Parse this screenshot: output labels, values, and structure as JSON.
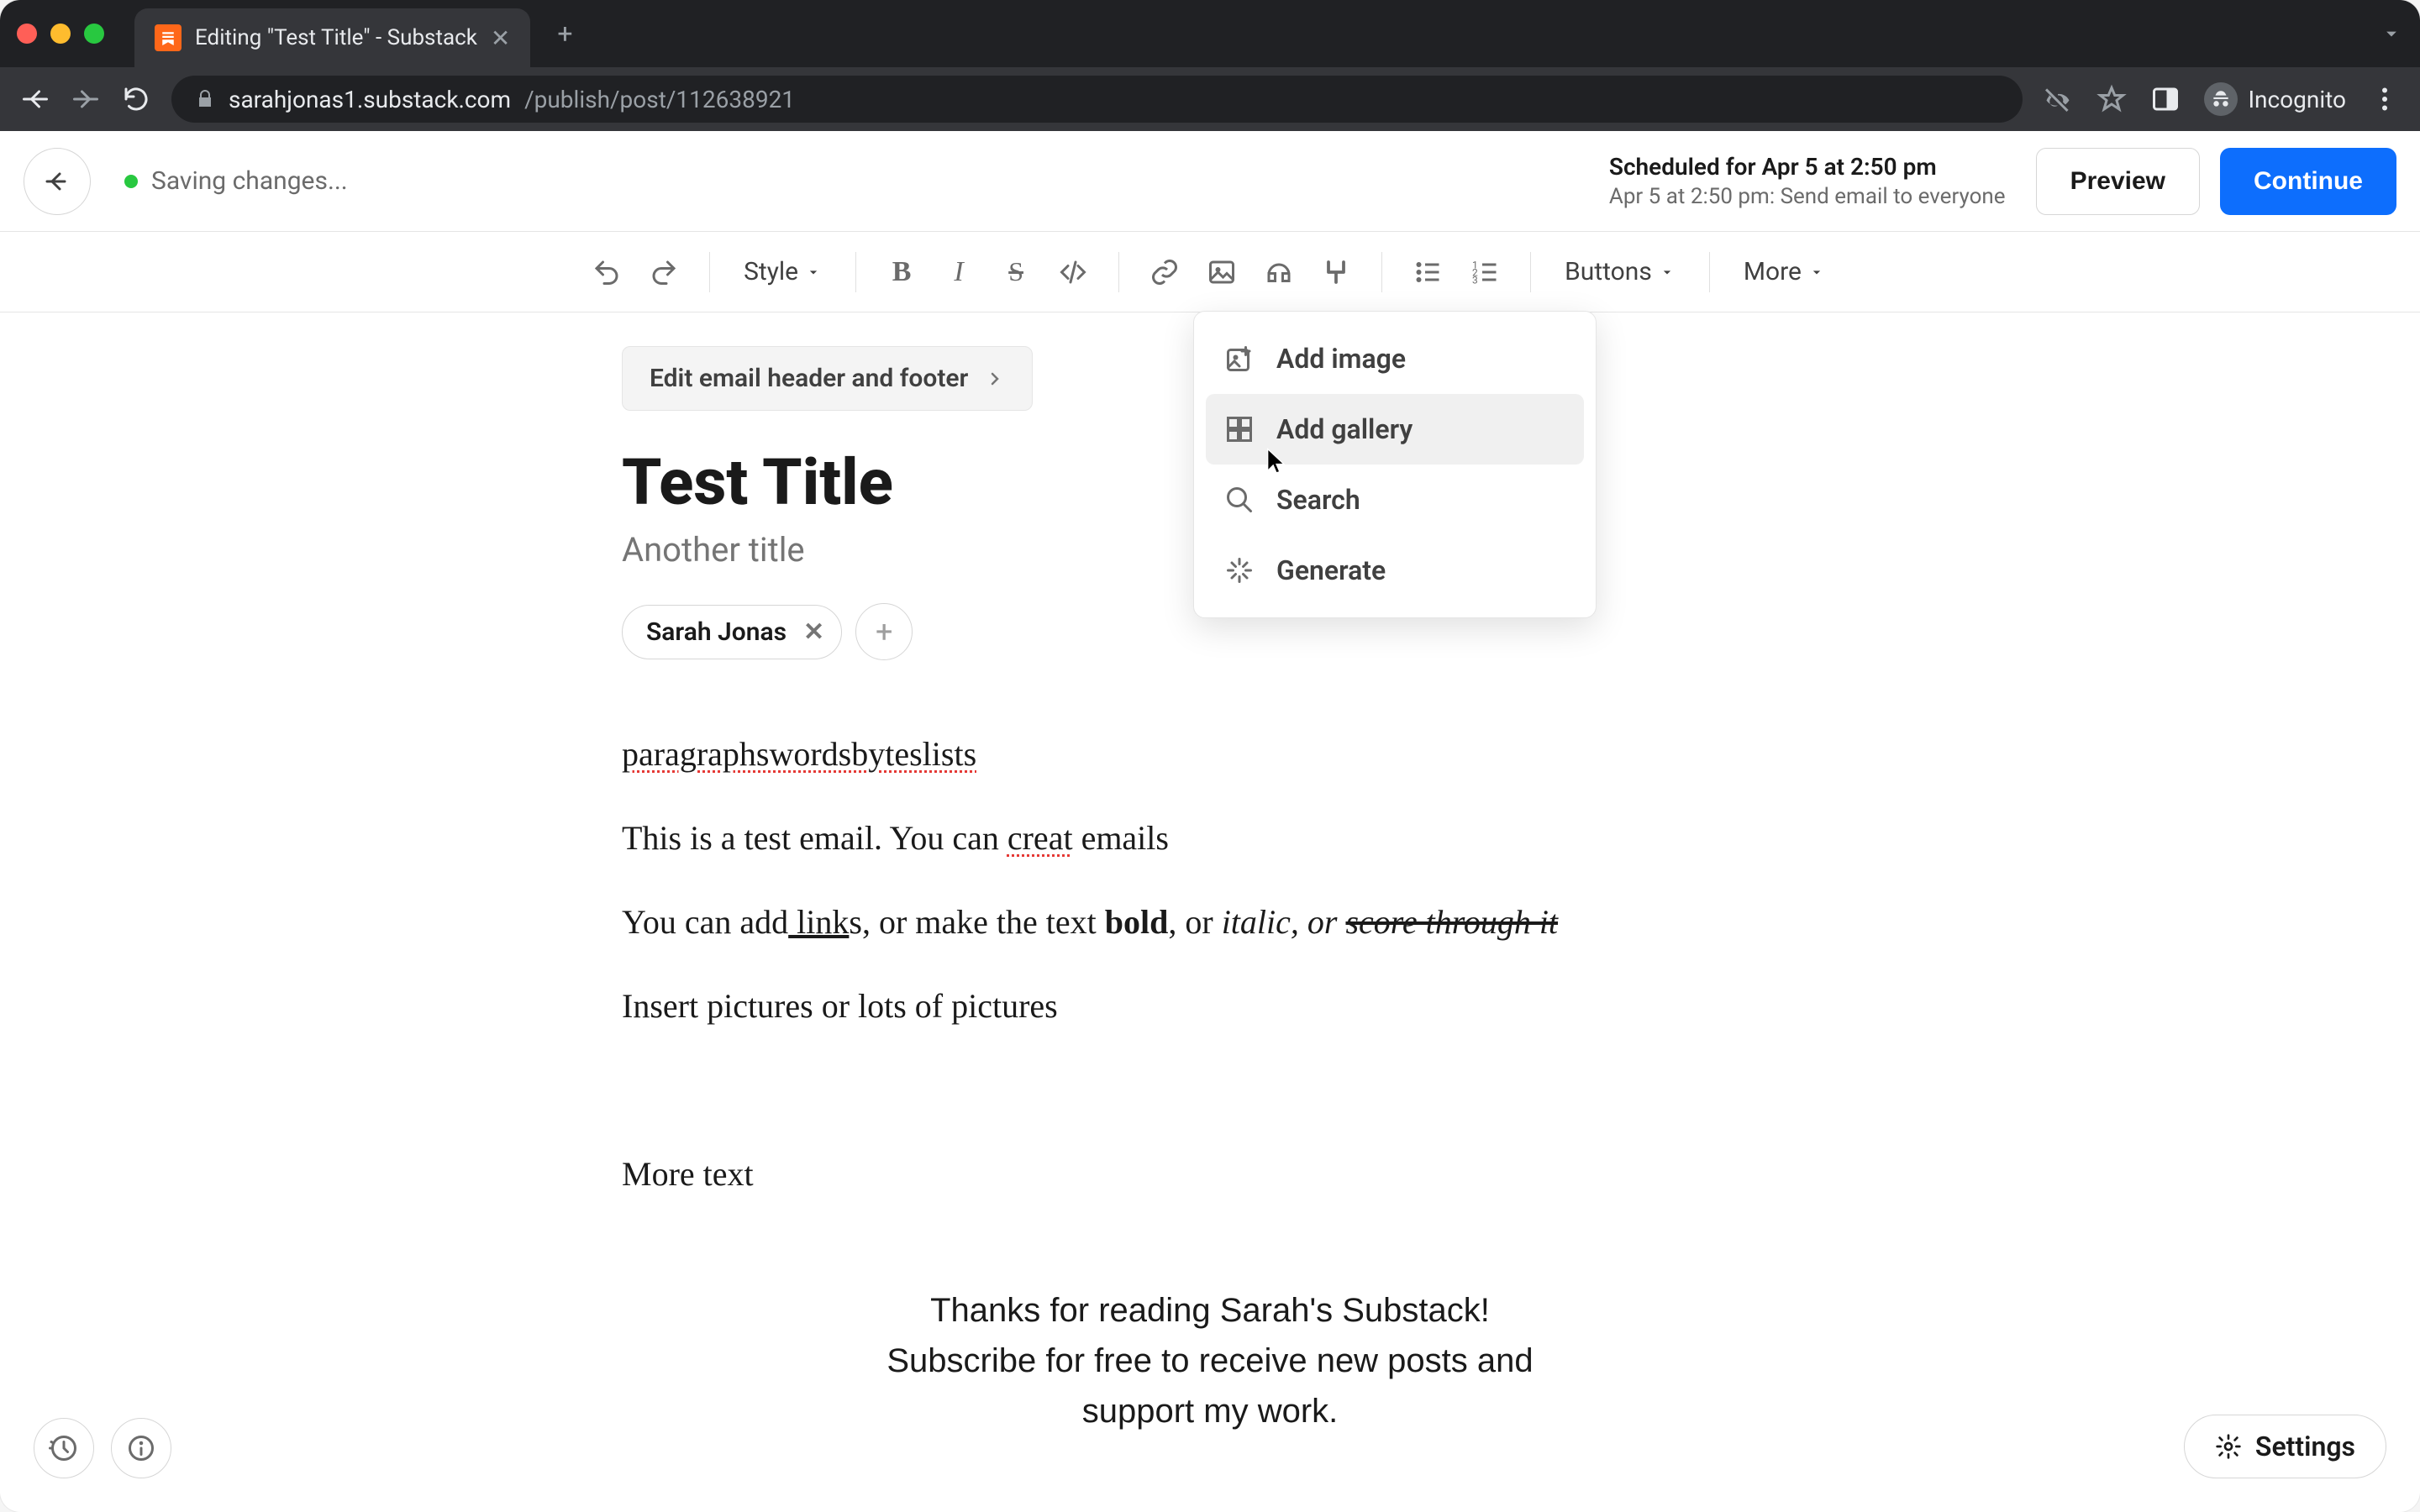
{
  "browser": {
    "tab_title": "Editing \"Test Title\" - Substack",
    "url_host": "sarahjonas1.substack.com",
    "url_path": "/publish/post/112638921",
    "incognito_label": "Incognito"
  },
  "header": {
    "save_status": "Saving changes...",
    "scheduled_title": "Scheduled for Apr 5 at 2:50 pm",
    "scheduled_sub": "Apr 5 at 2:50 pm: Send email to everyone",
    "preview_label": "Preview",
    "continue_label": "Continue"
  },
  "toolbar": {
    "style_label": "Style",
    "buttons_label": "Buttons",
    "more_label": "More"
  },
  "dropdown": {
    "add_image": "Add image",
    "add_gallery": "Add gallery",
    "search": "Search",
    "generate": "Generate"
  },
  "editor": {
    "email_header_btn": "Edit email header and footer",
    "title": "Test Title",
    "subtitle": "Another title",
    "author_name": "Sarah Jonas",
    "p1": "paragraphswordsbyteslists",
    "p2_a": "This is a test email. You can ",
    "p2_spell": "creat",
    "p2_b": " emails",
    "p3_a": "You can add",
    "p3_link": " link",
    "p3_b": "s, or make the text ",
    "p3_bold": "bold",
    "p3_c": ", or ",
    "p3_italic": "italic, or ",
    "p3_strike": "score through it",
    "p4": "Insert pictures or lots of pictures",
    "p5": "More text",
    "thanks_l1": "Thanks for reading Sarah's Substack!",
    "thanks_l2": "Subscribe for free to receive new posts and",
    "thanks_l3": "support my work."
  },
  "footer": {
    "settings_label": "Settings"
  }
}
